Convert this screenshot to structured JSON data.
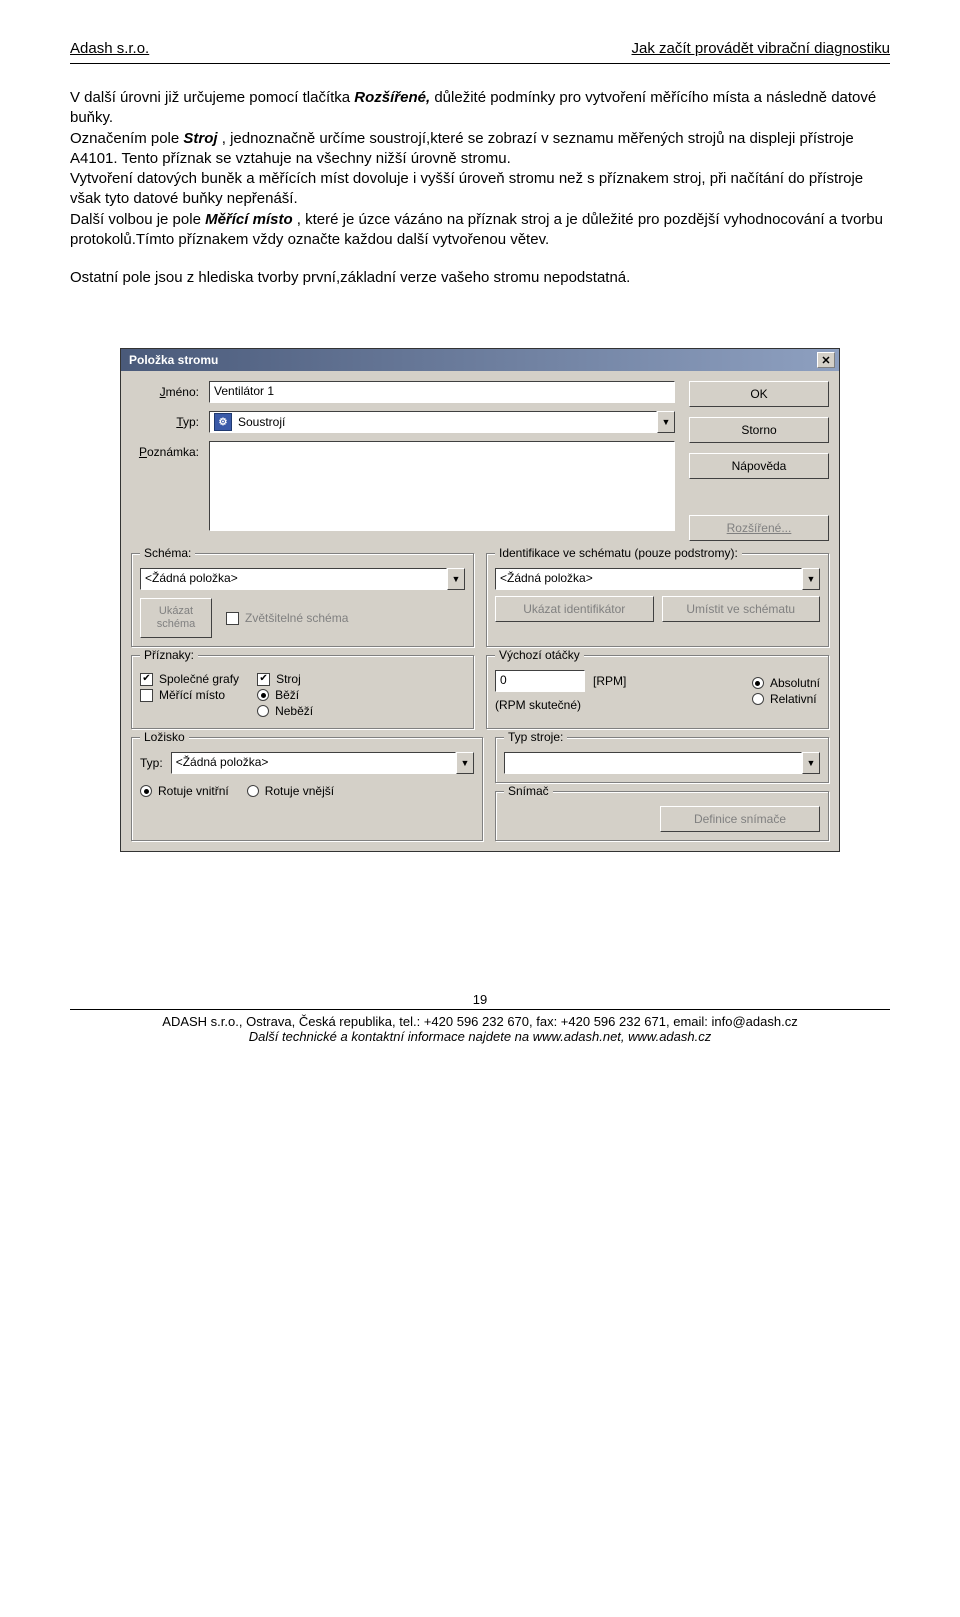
{
  "header": {
    "left": "Adash s.r.o.",
    "right": "Jak začít provádět vibrační diagnostiku"
  },
  "body": {
    "p1a": "V další úrovni již určujeme pomocí tlačítka ",
    "p1b": "Rozšířené,",
    "p1c": " důležité podmínky pro vytvoření měřícího místa a následně datové buňky.",
    "p2a": "Označením pole ",
    "p2b": "Stroj",
    "p2c": ", jednoznačně určíme soustrojí,které se zobrazí v seznamu měřených strojů na displeji přístroje A4101. Tento příznak se vztahuje na všechny nižší úrovně stromu.",
    "p3": "Vytvoření datových buněk a měřících míst dovoluje i vyšší úroveň stromu než s příznakem stroj, při načítání do přístroje však tyto datové buňky nepřenáší.",
    "p4a": "Další volbou je pole ",
    "p4b": "Měřící místo",
    "p4c": ", které je úzce vázáno na příznak stroj a je důležité pro pozdější vyhodnocování a tvorbu protokolů.Tímto příznakem vždy označte každou další vytvořenou větev.",
    "p5": "Ostatní pole jsou z hlediska tvorby první,základní verze vašeho stromu nepodstatná."
  },
  "dialog": {
    "title": "Položka stromu",
    "labels": {
      "jmeno": "Jméno:",
      "typ": "Typ:",
      "poznamka": "Poznámka:"
    },
    "fields": {
      "jmeno": "Ventilátor 1",
      "typ": "Soustrojí"
    },
    "buttons": {
      "ok": "OK",
      "storno": "Storno",
      "napoveda": "Nápověda",
      "rozsirene": "Rozšířené..."
    },
    "schemaGroup": {
      "legend": "Schéma:",
      "value": "<Žádná položka>",
      "ukazat": "Ukázat schéma",
      "zvetsitelne": "Zvětšitelné schéma"
    },
    "identGroup": {
      "legend": "Identifikace ve schématu (pouze podstromy):",
      "value": "<Žádná položka>",
      "ukazat": "Ukázat identifikátor",
      "umistit": "Umístit ve schématu"
    },
    "priznaky": {
      "legend": "Příznaky:",
      "spolecne": "Společné grafy",
      "merici": "Měřící místo",
      "stroj": "Stroj",
      "bezi": "Běží",
      "nebezi": "Neběží"
    },
    "otacky": {
      "legend": "Výchozí otáčky",
      "value": "0",
      "unit": "[RPM]",
      "skutecne": "(RPM skutečné)",
      "abs": "Absolutní",
      "rel": "Relativní"
    },
    "lozisko": {
      "legend": "Ložisko",
      "typ": "Typ:",
      "value": "<Žádná položka>",
      "rvnitrni": "Rotuje vnitřní",
      "rvnejsi": "Rotuje vnější"
    },
    "typstroje": {
      "legend": "Typ stroje:",
      "value": ""
    },
    "snimac": {
      "legend": "Snímač",
      "btn": "Definice snímače"
    }
  },
  "footer": {
    "pagenum": "19",
    "line1": "ADASH s.r.o., Ostrava, Česká republika, tel.: +420 596 232 670, fax: +420 596 232 671, email: info@adash.cz",
    "line2": "Další technické a kontaktní informace najdete na www.adash.net, www.adash.cz"
  }
}
